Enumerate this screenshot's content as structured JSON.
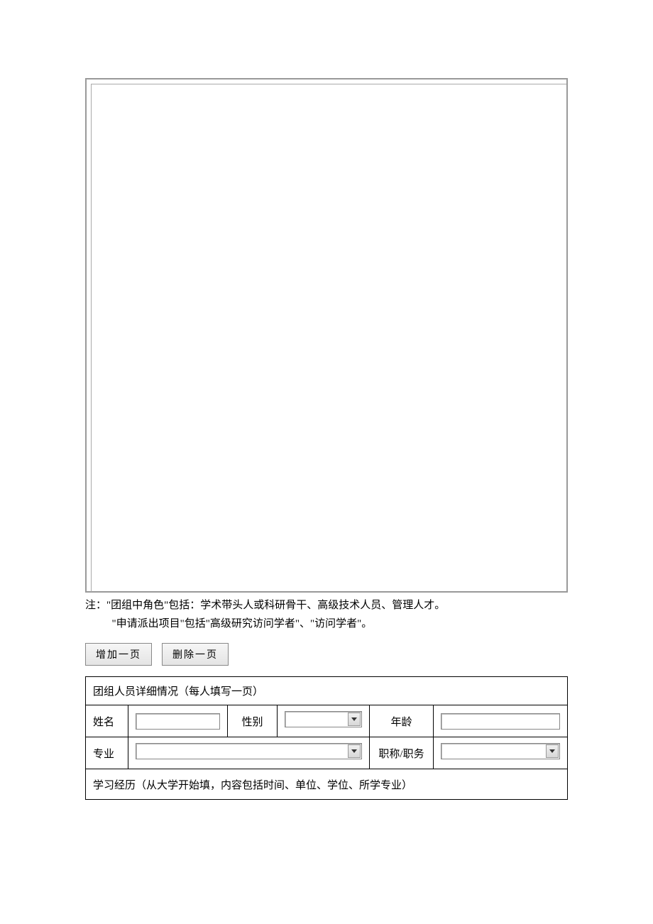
{
  "notes": {
    "line1": "注：\"团组中角色\"包括：学术带头人或科研骨干、高级技术人员、管理人才。",
    "line2": "\"申请派出项目\"包括\"高级研究访问学者\"、\"访问学者\"。"
  },
  "buttons": {
    "add_page": "增加一页",
    "delete_page": "删除一页"
  },
  "form": {
    "header": "团组人员详细情况（每人填写一页）",
    "labels": {
      "name": "姓名",
      "gender": "性别",
      "age": "年龄",
      "major": "专业",
      "title_position": "职称/职务",
      "education": "学习经历（从大学开始填，内容包括时间、单位、学位、所学专业）"
    },
    "values": {
      "name": "",
      "gender": "",
      "age": "",
      "major": "",
      "title_position": ""
    }
  }
}
